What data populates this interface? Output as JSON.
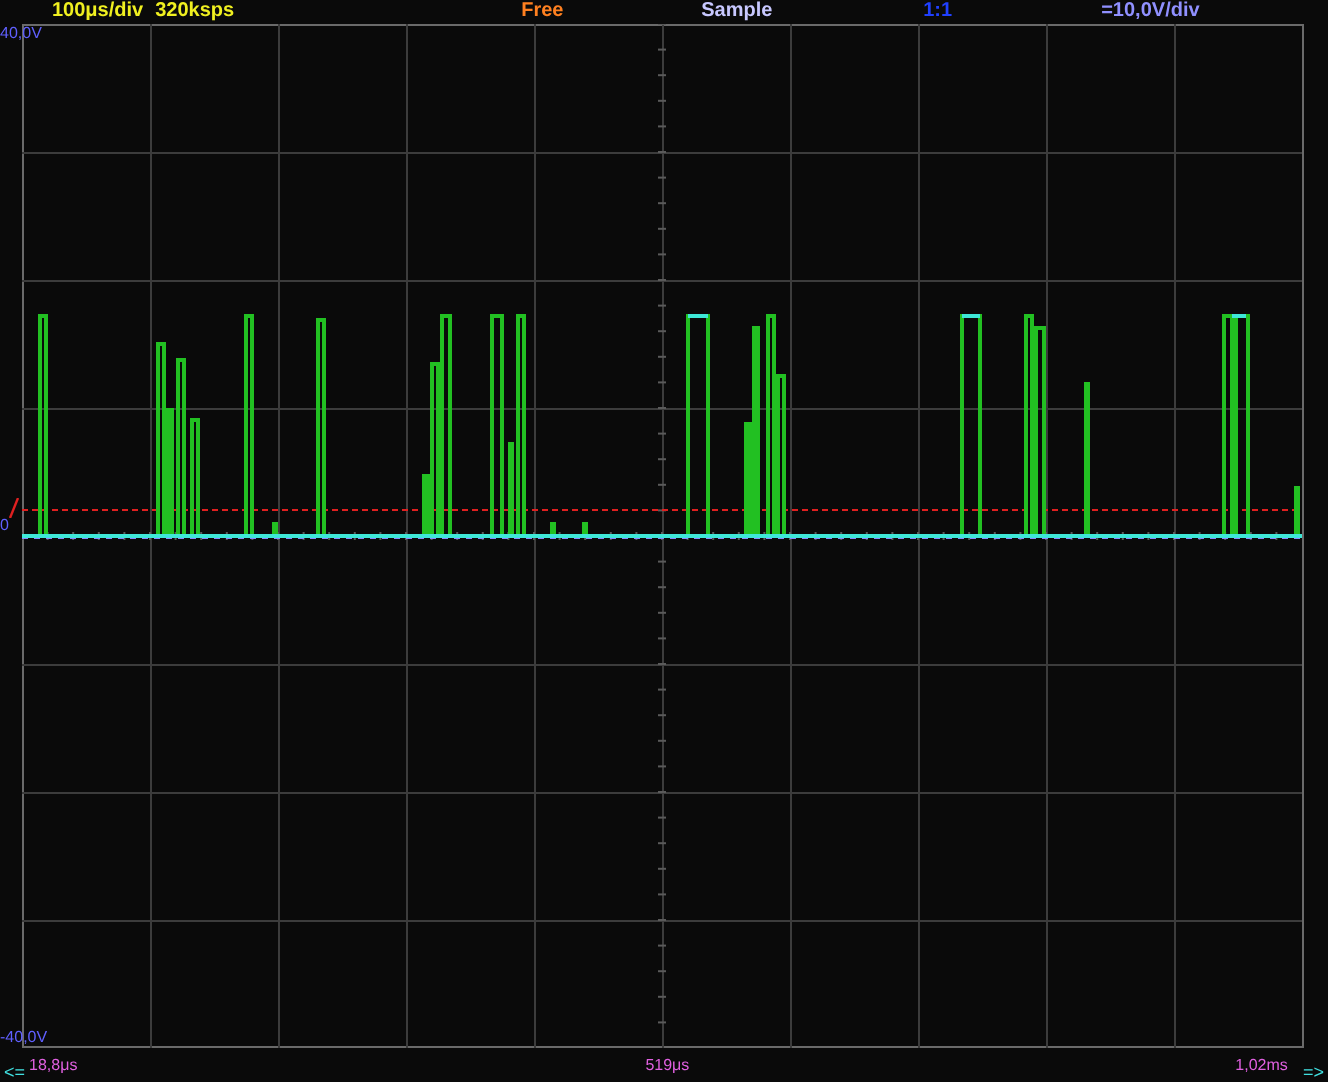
{
  "status_bar": {
    "timebase": "100μs/div",
    "sample_rate": "320ksps",
    "trigger_mode": "Free",
    "acquisition": "Sample",
    "probe": "1:1",
    "vertical_scale": "=10,0V/div"
  },
  "vertical_labels": {
    "top": "40,0V",
    "zero": "0",
    "bottom": "-40,0V"
  },
  "time_axis": {
    "scroll_left": "<=",
    "start": "18,8μs",
    "center": "519μs",
    "end": "1,02ms",
    "scroll_right": "=>"
  }
}
